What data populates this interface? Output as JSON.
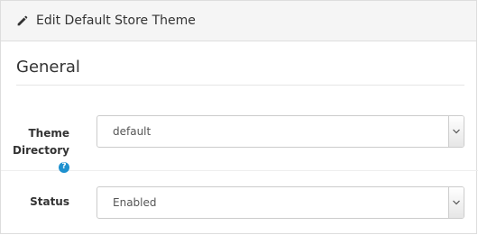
{
  "header": {
    "title": "Edit Default Store Theme",
    "icon": "pencil-icon"
  },
  "section": {
    "legend": "General"
  },
  "fields": {
    "theme_directory": {
      "label_line1": "Theme",
      "label_line2": "Directory",
      "help_icon": "?",
      "value": "default"
    },
    "status": {
      "label": "Status",
      "value": "Enabled"
    }
  },
  "colors": {
    "help_icon": "#1e91cf",
    "heading_bg": "#f5f5f5"
  }
}
